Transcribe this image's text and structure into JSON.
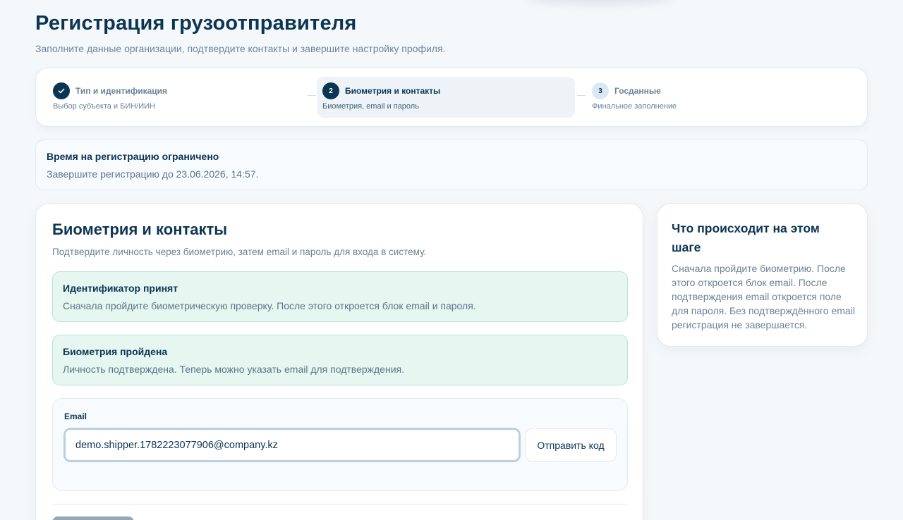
{
  "header": {
    "title": "Регистрация грузоотправителя",
    "subtitle": "Заполните данные организации, подтвердите контакты и завершите настройку профиля."
  },
  "stepper": {
    "steps": [
      {
        "number": "✓",
        "label": "Тип и идентификация",
        "sub": "Выбор субъекта и БИН/ИИН",
        "state": "done"
      },
      {
        "number": "2",
        "label": "Биометрия и контакты",
        "sub": "Биометрия, email и пароль",
        "state": "active"
      },
      {
        "number": "3",
        "label": "Госданные",
        "sub": "Финальное заполнение",
        "state": "pending"
      }
    ]
  },
  "notice": {
    "title": "Время на регистрацию ограничено",
    "text": "Завершите регистрацию до 23.06.2026, 14:57."
  },
  "main": {
    "title": "Биометрия и контакты",
    "subtitle": "Подтвердите личность через биометрию, затем email и пароль для входа в систему.",
    "alerts": [
      {
        "title": "Идентификатор принят",
        "text": "Сначала пройдите биометрическую проверку. После этого откроется блок email и пароля."
      },
      {
        "title": "Биометрия пройдена",
        "text": "Личность подтверждена. Теперь можно указать email для подтверждения."
      }
    ],
    "email": {
      "label": "Email",
      "value": "demo.shipper.1782223077906@company.kz",
      "send_label": "Отправить код"
    }
  },
  "side": {
    "title": "Что происходит на этом шаге",
    "text": "Сначала пройдите биометрию. После этого откроется блок email. После подтверждения email откроется поле для пароля. Без подтверждённого email регистрация не завершается."
  },
  "colors": {
    "primary": "#0c3553",
    "success_bg": "#e6f6f0",
    "success_border": "#bfe3d4",
    "muted_text": "#6a8293"
  }
}
